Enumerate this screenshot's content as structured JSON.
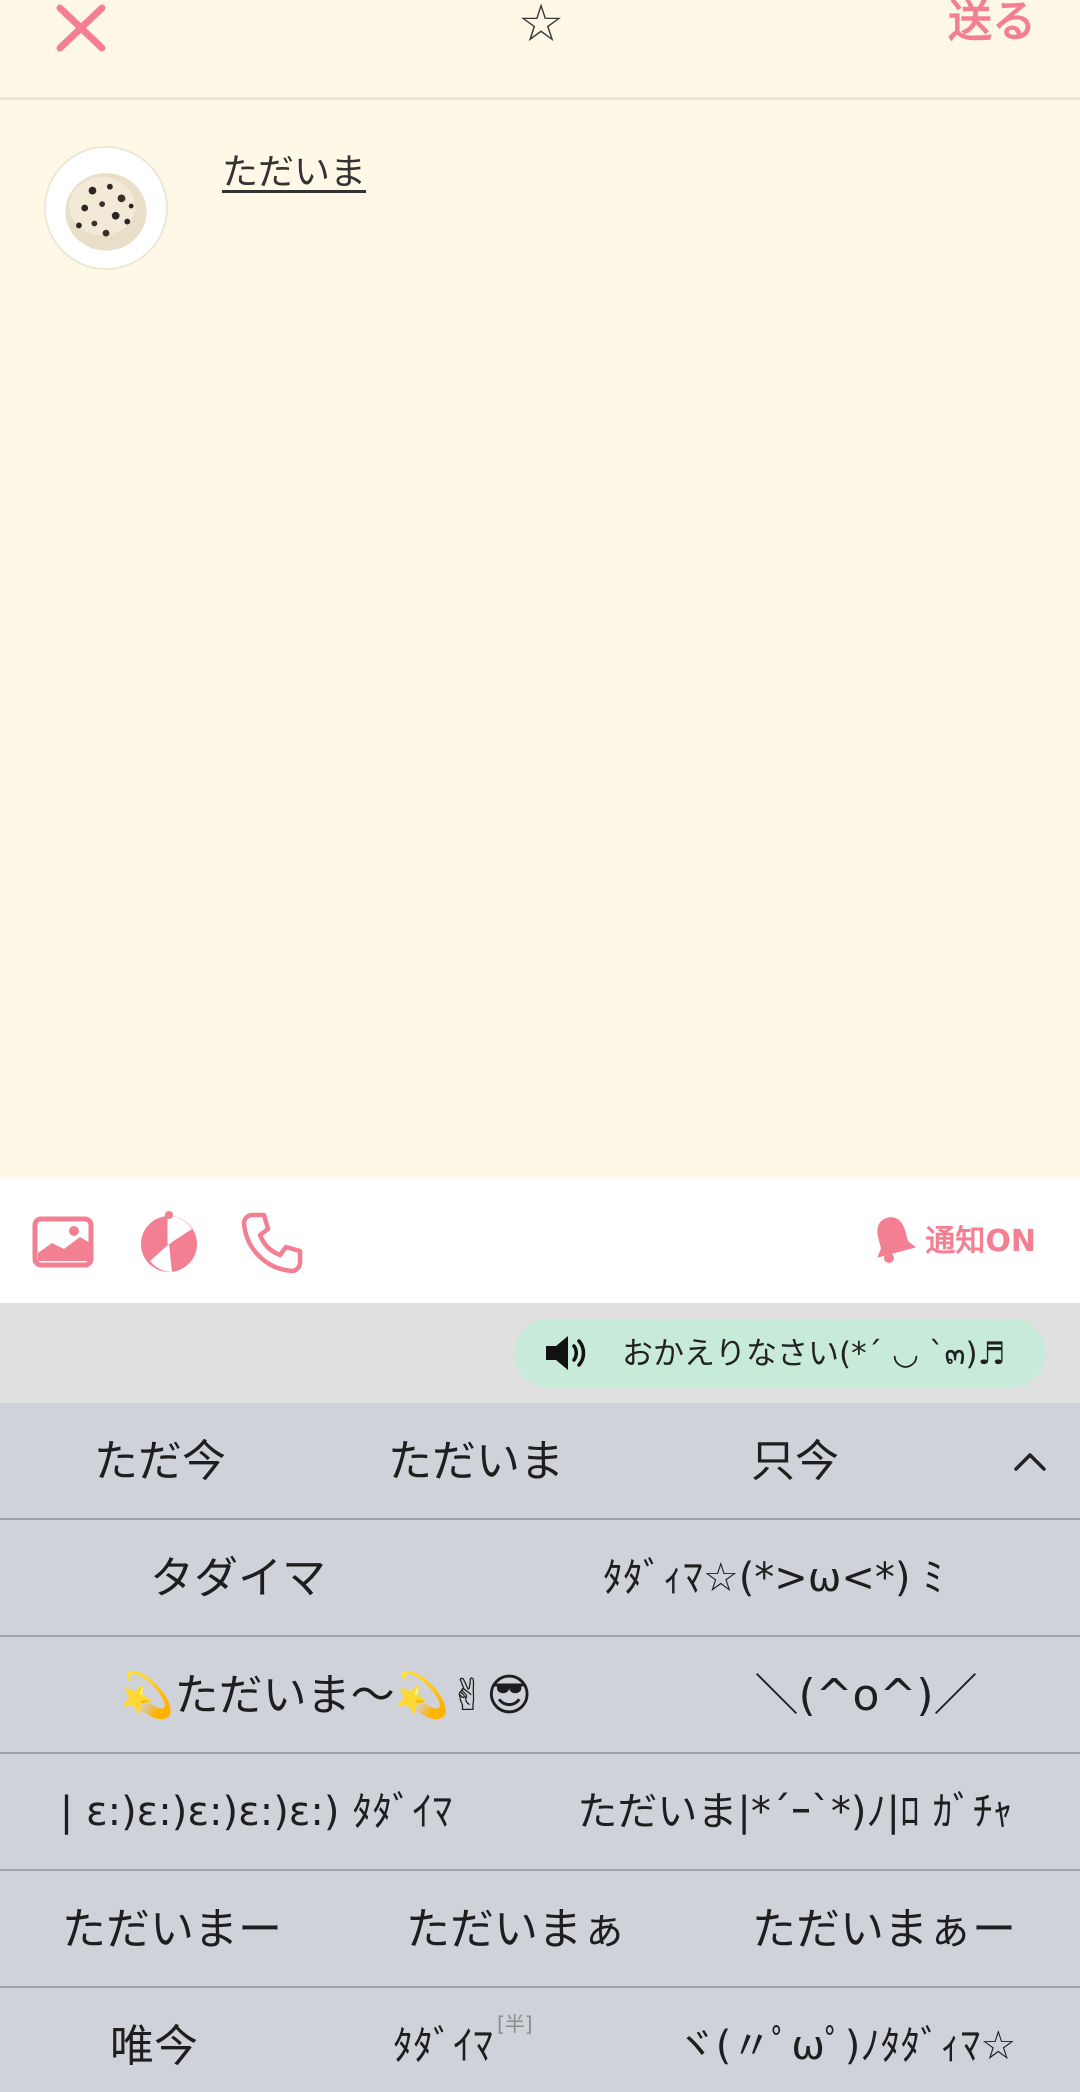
{
  "header": {
    "close_icon": "close-x-icon",
    "star_label": "☆",
    "send_label": "送る",
    "accent_color": "#f37f93"
  },
  "message": {
    "text": "ただいま",
    "avatar_icon": "cookie-ice-cream-avatar"
  },
  "toolbar": {
    "icons": [
      "image-icon",
      "pie-chart-icon",
      "phone-icon"
    ],
    "notify_label": "通知ON",
    "notify_icon": "bell-icon"
  },
  "suggestion": {
    "icon": "speaker-icon",
    "text": "おかえりなさい(*´ ◡ `๓)♬"
  },
  "candidates": {
    "rows": [
      [
        "ただ今",
        "ただいま",
        "只今"
      ],
      [
        "タダイマ",
        "ﾀﾀﾞｨﾏ☆(*>ω<*) ﾐ"
      ],
      [
        "💫ただいま〜💫✌😎",
        "＼(^o^)／"
      ],
      [
        "| ε:)ε:)ε:)ε:)ε:) ﾀﾀﾞｲﾏ",
        "ただいま|*´ｰ`*)ﾉ|ﾛ ｶﾞﾁｬ"
      ],
      [
        "ただいまー",
        "ただいまぁ",
        "ただいまぁー"
      ],
      [
        "唯今",
        "ﾀﾀﾞｲﾏ",
        "ヾ(〃ﾟωﾟ)ﾉﾀﾀﾞｨﾏ☆"
      ]
    ],
    "han_label": "[半]",
    "collapse_icon": "chevron-up-icon"
  }
}
